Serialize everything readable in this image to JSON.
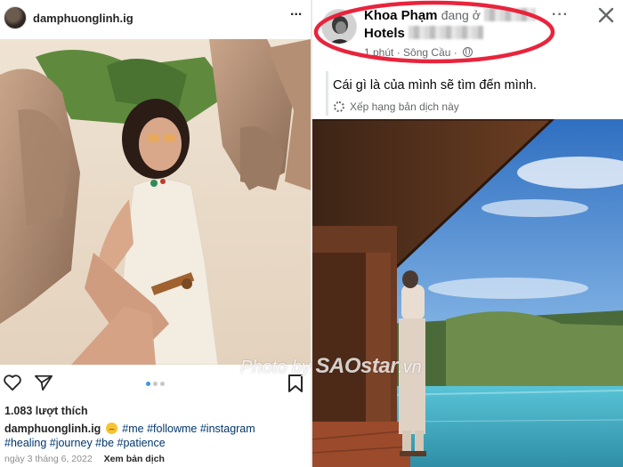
{
  "instagram": {
    "username": "damphuonglinh.ig",
    "more_label": "...",
    "likes": "1.083 lượt thích",
    "caption": {
      "username": "damphuonglinh.ig",
      "hashtags_line1": "#me #followme #instagram",
      "hashtags_line2": "#healing #journey #be #patience"
    },
    "date": "ngày 3 tháng 6, 2022",
    "translate": "Xem bản dịch",
    "carousel": {
      "total": 3,
      "active": 1
    },
    "icons": [
      "heart-icon",
      "send-icon",
      "bookmark-icon",
      "smiling-emoji-icon"
    ]
  },
  "facebook": {
    "author": "Khoa Phạm",
    "at_text": "đang ở",
    "hotel": "Hotels",
    "time": "1 phút",
    "location": "Sông Cầu",
    "more_label": "···",
    "post_text": "Cái gì là của mình sẽ tìm đến mình.",
    "rate_translation": "Xếp hạng bản dịch này",
    "icons": [
      "globe-icon",
      "gear-icon",
      "close-icon"
    ],
    "highlight_color": "#e8243c"
  },
  "watermark": {
    "prefix": "Photo by",
    "brand": "SAOstar",
    "suffix": ".vn"
  }
}
